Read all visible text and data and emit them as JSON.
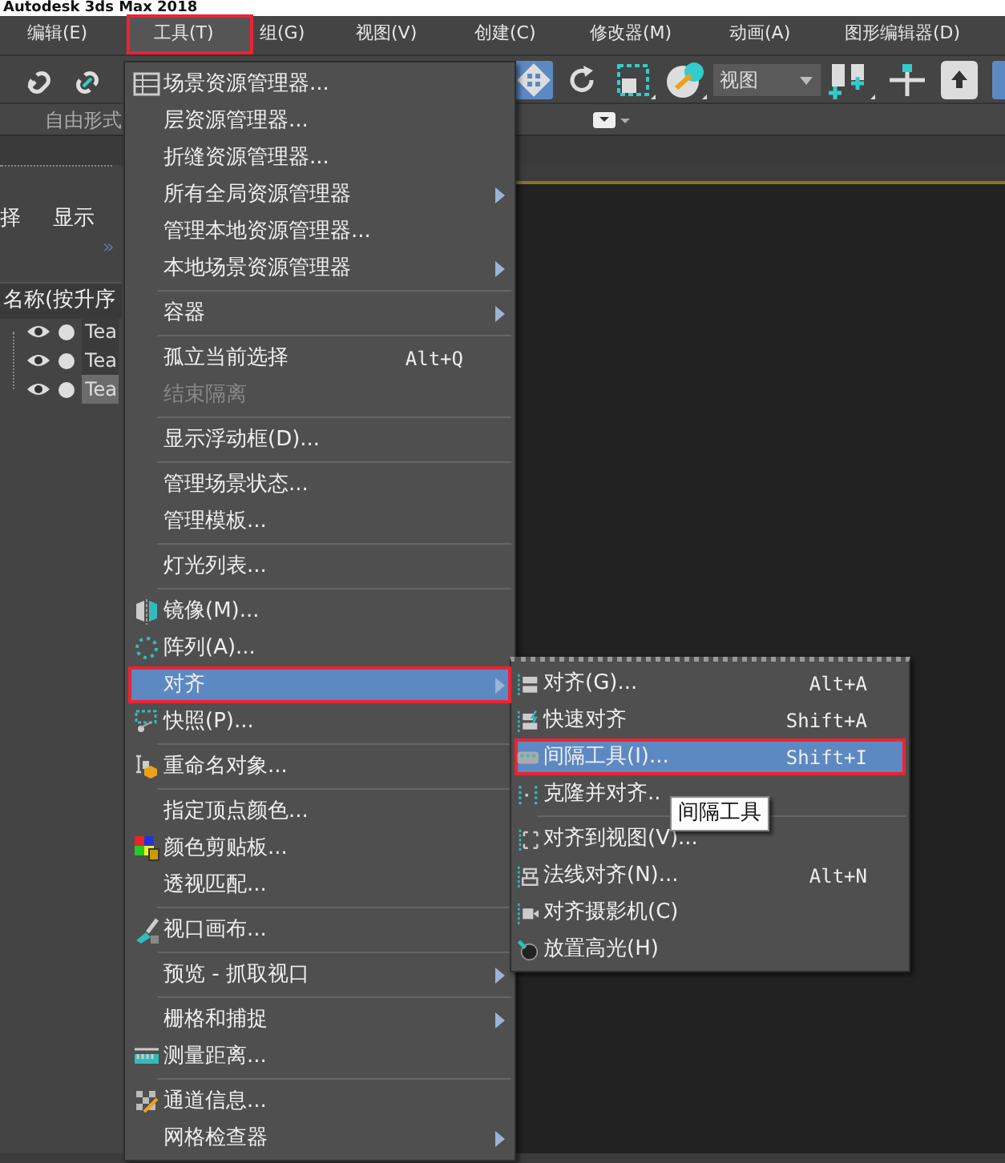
{
  "window": {
    "title": "Autodesk 3ds Max 2018"
  },
  "menubar": [
    {
      "label": "编辑(E)",
      "selected": false
    },
    {
      "label": "工具(T)",
      "selected": true,
      "outlined": true
    },
    {
      "label": "组(G)",
      "selected": false
    },
    {
      "label": "视图(V)",
      "selected": false
    },
    {
      "label": "创建(C)",
      "selected": false
    },
    {
      "label": "修改器(M)",
      "selected": false
    },
    {
      "label": "动画(A)",
      "selected": false
    },
    {
      "label": "图形编辑器(D)",
      "selected": false
    }
  ],
  "toolbar": {
    "dropdown": {
      "value": "视图"
    }
  },
  "ribbon": {
    "tab": "自由形式"
  },
  "scene_explorer": {
    "tabs": [
      "择",
      "显示"
    ],
    "expand": "»",
    "column_header": "名称(按升序",
    "rows": [
      {
        "name": "Tea",
        "selected": false
      },
      {
        "name": "Tea",
        "selected": false
      },
      {
        "name": "Tea",
        "selected": true
      }
    ]
  },
  "tools_menu": [
    {
      "kind": "item",
      "label": "场景资源管理器...",
      "selected": false,
      "disabled": false,
      "submenu": false
    },
    {
      "kind": "item",
      "label": "层资源管理器...",
      "selected": false,
      "disabled": false,
      "submenu": false
    },
    {
      "kind": "item",
      "label": "折缝资源管理器...",
      "selected": false,
      "disabled": false,
      "submenu": false
    },
    {
      "kind": "item",
      "label": "所有全局资源管理器",
      "selected": false,
      "disabled": false,
      "submenu": true
    },
    {
      "kind": "item",
      "label": "管理本地资源管理器...",
      "selected": false,
      "disabled": false,
      "submenu": false
    },
    {
      "kind": "item",
      "label": "本地场景资源管理器",
      "selected": false,
      "disabled": false,
      "submenu": true
    },
    {
      "kind": "separator"
    },
    {
      "kind": "item",
      "label": "容器",
      "selected": false,
      "disabled": false,
      "submenu": true
    },
    {
      "kind": "separator"
    },
    {
      "kind": "item",
      "label": "孤立当前选择",
      "shortcut": "Alt+Q",
      "selected": false,
      "disabled": false,
      "submenu": false
    },
    {
      "kind": "item",
      "label": "结束隔离",
      "selected": false,
      "disabled": true,
      "submenu": false
    },
    {
      "kind": "separator"
    },
    {
      "kind": "item",
      "label": "显示浮动框(D)...",
      "selected": false,
      "disabled": false,
      "submenu": false
    },
    {
      "kind": "separator"
    },
    {
      "kind": "item",
      "label": "管理场景状态...",
      "selected": false,
      "disabled": false,
      "submenu": false
    },
    {
      "kind": "item",
      "label": "管理模板...",
      "selected": false,
      "disabled": false,
      "submenu": false
    },
    {
      "kind": "separator"
    },
    {
      "kind": "item",
      "label": "灯光列表...",
      "selected": false,
      "disabled": false,
      "submenu": false
    },
    {
      "kind": "separator"
    },
    {
      "kind": "item",
      "label": "镜像(M)...",
      "selected": false,
      "disabled": false,
      "submenu": false
    },
    {
      "kind": "item",
      "label": "阵列(A)...",
      "selected": false,
      "disabled": false,
      "submenu": false
    },
    {
      "kind": "item",
      "label": "对齐",
      "selected": true,
      "disabled": false,
      "submenu": true,
      "outlined": true
    },
    {
      "kind": "item",
      "label": "快照(P)...",
      "selected": false,
      "disabled": false,
      "submenu": false
    },
    {
      "kind": "separator"
    },
    {
      "kind": "item",
      "label": "重命名对象...",
      "selected": false,
      "disabled": false,
      "submenu": false
    },
    {
      "kind": "separator"
    },
    {
      "kind": "item",
      "label": "指定顶点颜色...",
      "selected": false,
      "disabled": false,
      "submenu": false
    },
    {
      "kind": "item",
      "label": "颜色剪贴板...",
      "selected": false,
      "disabled": false,
      "submenu": false
    },
    {
      "kind": "item",
      "label": "透视匹配...",
      "selected": false,
      "disabled": false,
      "submenu": false
    },
    {
      "kind": "separator"
    },
    {
      "kind": "item",
      "label": "视口画布...",
      "selected": false,
      "disabled": false,
      "submenu": false
    },
    {
      "kind": "separator"
    },
    {
      "kind": "item",
      "label": "预览 - 抓取视口",
      "selected": false,
      "disabled": false,
      "submenu": true
    },
    {
      "kind": "separator"
    },
    {
      "kind": "item",
      "label": "栅格和捕捉",
      "selected": false,
      "disabled": false,
      "submenu": true
    },
    {
      "kind": "item",
      "label": "测量距离...",
      "selected": false,
      "disabled": false,
      "submenu": false
    },
    {
      "kind": "separator"
    },
    {
      "kind": "item",
      "label": "通道信息...",
      "selected": false,
      "disabled": false,
      "submenu": false
    },
    {
      "kind": "item",
      "label": "网格检查器",
      "selected": false,
      "disabled": false,
      "submenu": true
    }
  ],
  "align_submenu": [
    {
      "kind": "item",
      "label": "对齐(G)...",
      "shortcut": "Alt+A",
      "selected": false
    },
    {
      "kind": "item",
      "label": "快速对齐",
      "shortcut": "Shift+A",
      "selected": false
    },
    {
      "kind": "item",
      "label": "间隔工具(I)...",
      "shortcut": "Shift+I",
      "selected": true,
      "outlined": true
    },
    {
      "kind": "item",
      "label": "克隆并对齐..",
      "selected": false
    },
    {
      "kind": "separator"
    },
    {
      "kind": "item",
      "label": "对齐到视图(V)...",
      "selected": false
    },
    {
      "kind": "item",
      "label": "法线对齐(N)...",
      "shortcut": "Alt+N",
      "selected": false
    },
    {
      "kind": "item",
      "label": "对齐摄影机(C)",
      "selected": false
    },
    {
      "kind": "item",
      "label": "放置高光(H)",
      "selected": false
    }
  ],
  "tooltip": {
    "text": "间隔工具"
  }
}
